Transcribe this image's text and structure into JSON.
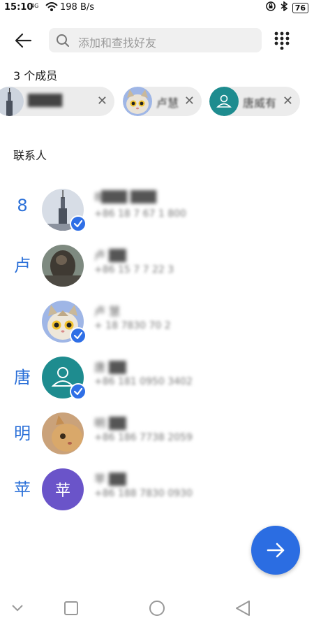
{
  "status_bar": {
    "time": "15:10",
    "network": "4G",
    "speed": "198 B/s",
    "battery": "76"
  },
  "search": {
    "placeholder": "添加和查找好友"
  },
  "members": {
    "title": "3 个成员",
    "chips": [
      {
        "name": "████"
      },
      {
        "name": "卢慧"
      },
      {
        "name": "唐威有"
      }
    ]
  },
  "contacts": {
    "title": "联系人",
    "rows": [
      {
        "letter": "8",
        "line1": "8███ ███",
        "line2": "+86 18 7 67 1 800",
        "selected": true
      },
      {
        "letter": "卢",
        "line1": "卢 ██",
        "line2": "+86 15 7  7 22 3",
        "selected": false
      },
      {
        "letter": "",
        "line1": "卢 慧",
        "line2": "+  18  7830 70 2",
        "selected": true
      },
      {
        "letter": "唐",
        "line1": "唐 ██",
        "line2": "+86 181 0950 3402",
        "selected": true
      },
      {
        "letter": "明",
        "line1": "明 ██",
        "line2": "+86 186 7738 2059",
        "selected": false
      },
      {
        "letter": "苹",
        "line1": "苹 ██",
        "line2": "+86 188 7830 0930",
        "selected": false
      }
    ],
    "avatar_text_ping": "苹"
  }
}
